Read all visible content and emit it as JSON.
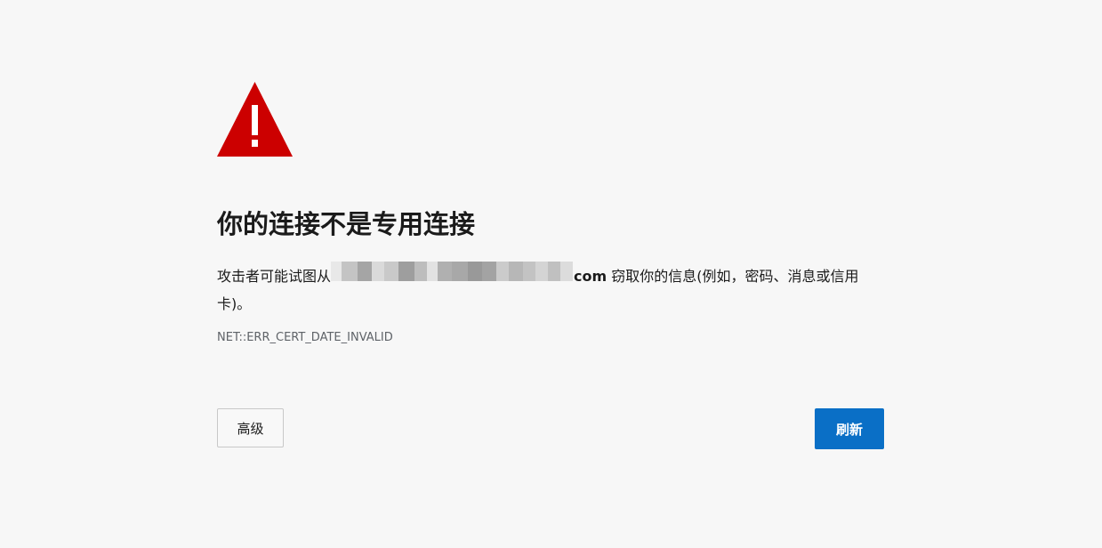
{
  "page": {
    "title": "你的连接不是专用连接",
    "description_prefix": "攻击者可能试图从",
    "host_suffix": "com",
    "description_suffix": " 窃取你的信息(例如，密码、消息或信用卡)。",
    "error_code": "NET::ERR_CERT_DATE_INVALID"
  },
  "buttons": {
    "advanced_label": "高级",
    "refresh_label": "刷新"
  },
  "colors": {
    "warning_red": "#cc0000",
    "primary_blue": "#0a6fc6",
    "background": "#f7f7f7"
  },
  "icons": {
    "warning": "warning-triangle-icon"
  }
}
